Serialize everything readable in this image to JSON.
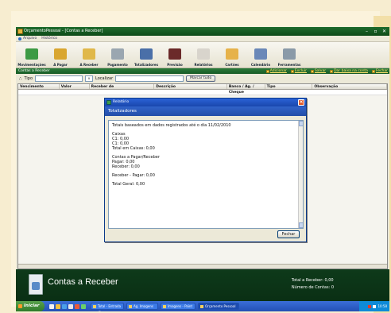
{
  "window": {
    "title": "OrçamentoPessoal - [Contas a Receber]"
  },
  "menu": [
    {
      "label": "Arquivo"
    },
    {
      "label": "Histórico"
    }
  ],
  "toolbar": [
    {
      "label": "Movimentações",
      "color": "#3c9a44"
    },
    {
      "label": "A Pagar",
      "color": "#d9a630"
    },
    {
      "label": "A Receber",
      "color": "#e0b84a"
    },
    {
      "label": "Pagamento",
      "color": "#9aa6b0"
    },
    {
      "label": "Totalizadores",
      "color": "#4a6fa8"
    },
    {
      "label": "Previsão",
      "color": "#6b2a2a"
    },
    {
      "label": "Relatórios",
      "color": "#d8d4cc"
    },
    {
      "label": "Cartões",
      "color": "#e6b24a"
    },
    {
      "label": "Calendário",
      "color": "#6a88b8"
    },
    {
      "label": "Ferramentas",
      "color": "#8a9aa8"
    }
  ],
  "panel": {
    "title": "Contas a Receber",
    "actions": [
      "Adicionar",
      "Excluir",
      "Salvar",
      "Dar baixa na conta",
      "Fechar"
    ]
  },
  "filter": {
    "tipo_label": "Tipo",
    "combo": "v",
    "localizar_label": "Localizar",
    "button": "Marcar tudo"
  },
  "grid": {
    "columns": [
      {
        "label": "Vencimento",
        "w": 52
      },
      {
        "label": "Valor",
        "w": 38
      },
      {
        "label": "Receber de",
        "w": 82
      },
      {
        "label": "Descrição",
        "w": 92
      },
      {
        "label": "Banco / Ag. / Cheque",
        "w": 48
      },
      {
        "label": "Tipo",
        "w": 60
      },
      {
        "label": "Observação",
        "w": 94
      }
    ]
  },
  "footer": {
    "title": "Contas a Receber",
    "total_receber": "Total a Receber: 0,00",
    "numero_contas": "Número de Contas: 0"
  },
  "taskbar": {
    "start": "Iniciar",
    "tasks": [
      {
        "label": "Total - Entrada (3 ..."
      },
      {
        "label": "Ag. Imagens"
      },
      {
        "label": "Imagens - Paint"
      },
      {
        "label": "Orçamento Pessoal ..."
      }
    ],
    "clock": "10:58"
  },
  "dialog": {
    "window_title": "Relatório",
    "header": "Totalizadores",
    "lines": [
      "Totais baseados em dados registrados até o dia 11/02/2010",
      "",
      "Caixas",
      "C1: 0,00",
      "C1: 0,00",
      "Total em Caixas: 0,00",
      "",
      "Contas a Pagar/Receber",
      "Pagar: 0,00",
      "Receber: 0,00",
      "",
      "Receber - Pagar: 0,00",
      "",
      "Total Geral: 0,00"
    ],
    "close_button": "Fechar"
  }
}
